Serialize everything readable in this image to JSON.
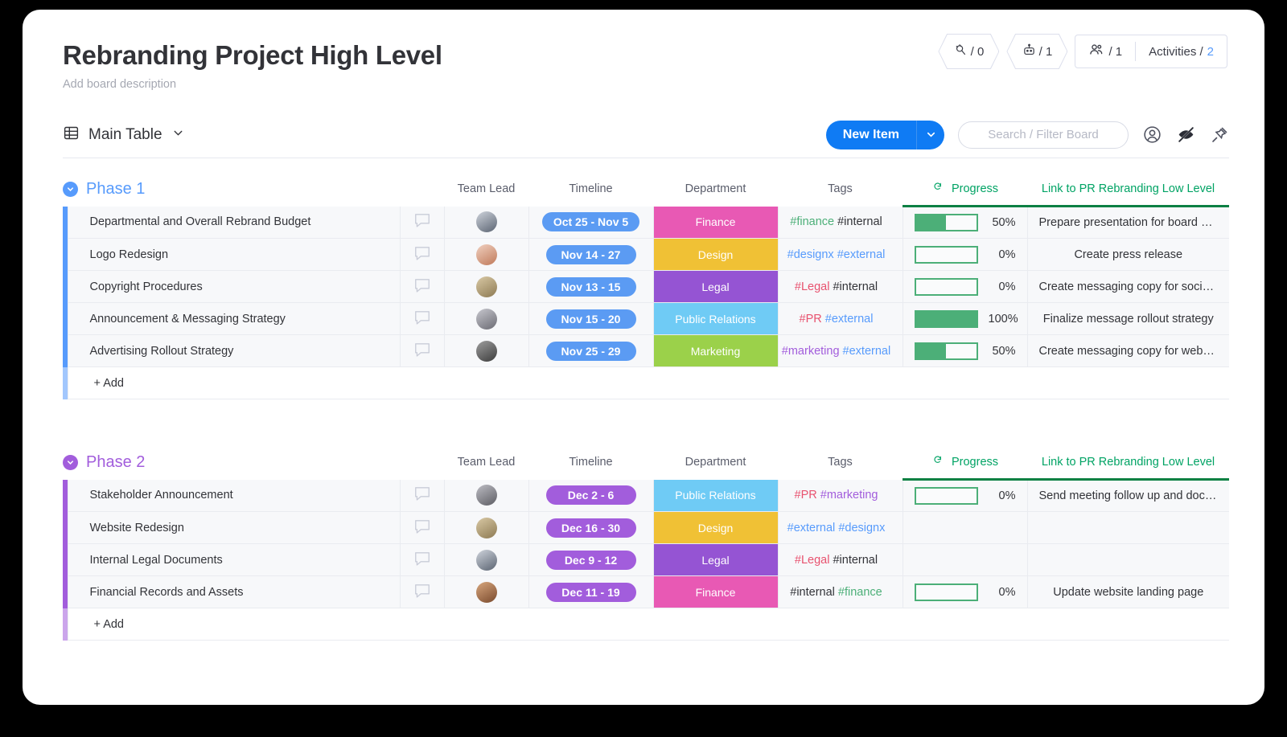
{
  "header": {
    "title": "Rebranding Project High Level",
    "description": "Add board description",
    "badges": [
      {
        "icon": "automation-icon",
        "value": "/ 0"
      },
      {
        "icon": "robot-icon",
        "value": "/ 1"
      }
    ],
    "members": {
      "icon": "people-icon",
      "value": "/ 1"
    },
    "activities": {
      "label": "Activities /",
      "count": "2"
    }
  },
  "toolbar": {
    "view_icon": "table-icon",
    "view_label": "Main Table",
    "view_chevron": "chevron-down-icon",
    "new_item_label": "New Item",
    "new_item_chevron": "chevron-down-icon",
    "search_placeholder": "Search / Filter Board",
    "person_icon": "person-icon",
    "hide_icon": "eye-off-icon",
    "pin_icon": "pin-icon"
  },
  "columns": {
    "team_lead": "Team Lead",
    "timeline": "Timeline",
    "department": "Department",
    "tags": "Tags",
    "progress": "Progress",
    "progress_icon": "rotate-icon",
    "link": "Link to PR Rebranding Low Level"
  },
  "colors": {
    "phase1_accent": "#579bfc",
    "phase2_accent": "#a25ddc",
    "finance": "#e859b4",
    "design": "#f0c135",
    "legal": "#9554d3",
    "public_relations": "#6fcbf5",
    "marketing": "#9bd14a",
    "progress_green": "#4caf78",
    "header_green": "#00a364",
    "new_item_blue": "#0f7bf4"
  },
  "add_row_label": "+ Add",
  "groups": [
    {
      "name": "Phase 1",
      "accent": "#579bfc",
      "rows": [
        {
          "name": "Departmental and Overall Rebrand Budget",
          "avatar": [
            "#5b6472",
            "#cfd4dc"
          ],
          "timeline": "Oct 25 - Nov 5",
          "timeline_color": "#5b9bf3",
          "department": "Finance",
          "department_color": "#e859b4",
          "tags": [
            {
              "text": "#finance",
              "color": "#4caf78"
            },
            {
              "text": "#internal",
              "color": "#323338"
            }
          ],
          "progress": 50,
          "progress_label": "50%",
          "link": "Prepare presentation for board memb…"
        },
        {
          "name": "Logo Redesign",
          "avatar": [
            "#c07a5a",
            "#f0d0c0"
          ],
          "timeline": "Nov 14 - 27",
          "timeline_color": "#5b9bf3",
          "department": "Design",
          "department_color": "#f0c135",
          "tags": [
            {
              "text": "#designx",
              "color": "#579bfc"
            },
            {
              "text": "#external",
              "color": "#579bfc"
            }
          ],
          "progress": 0,
          "progress_label": "0%",
          "link": "Create press release"
        },
        {
          "name": "Copyright Procedures",
          "avatar": [
            "#8d7a53",
            "#d9c9a5"
          ],
          "timeline": "Nov 13 - 15",
          "timeline_color": "#5b9bf3",
          "department": "Legal",
          "department_color": "#9554d3",
          "tags": [
            {
              "text": "#Legal",
              "color": "#e8526f"
            },
            {
              "text": "#internal",
              "color": "#323338"
            }
          ],
          "progress": 0,
          "progress_label": "0%",
          "link": "Create messaging copy for social plat…"
        },
        {
          "name": "Announcement & Messaging Strategy",
          "avatar": [
            "#6b6b73",
            "#c8c8cf"
          ],
          "timeline": "Nov 15 - 20",
          "timeline_color": "#5b9bf3",
          "department": "Public Relations",
          "department_color": "#6fcbf5",
          "tags": [
            {
              "text": "#PR",
              "color": "#e8526f"
            },
            {
              "text": "#external",
              "color": "#579bfc"
            }
          ],
          "progress": 100,
          "progress_label": "100%",
          "link": "Finalize message rollout strategy"
        },
        {
          "name": "Advertising Rollout Strategy",
          "avatar": [
            "#3d3d3d",
            "#9e9e9e"
          ],
          "timeline": "Nov 25 - 29",
          "timeline_color": "#5b9bf3",
          "department": "Marketing",
          "department_color": "#9bd14a",
          "tags": [
            {
              "text": "#marketing",
              "color": "#a25ddc"
            },
            {
              "text": "#external",
              "color": "#579bfc"
            }
          ],
          "progress": 50,
          "progress_label": "50%",
          "link": "Create messaging copy for website la…"
        }
      ]
    },
    {
      "name": "Phase 2",
      "accent": "#a25ddc",
      "rows": [
        {
          "name": "Stakeholder Announcement",
          "avatar": [
            "#5d5d63",
            "#bdbdc4"
          ],
          "timeline": "Dec 2 - 6",
          "timeline_color": "#a25ddc",
          "department": "Public Relations",
          "department_color": "#6fcbf5",
          "tags": [
            {
              "text": "#PR",
              "color": "#e8526f"
            },
            {
              "text": "#marketing",
              "color": "#a25ddc"
            }
          ],
          "progress": 0,
          "progress_label": "0%",
          "link": "Send meeting follow up and documen…"
        },
        {
          "name": "Website Redesign",
          "avatar": [
            "#8d7a53",
            "#d9c9a5"
          ],
          "timeline": "Dec 16 - 30",
          "timeline_color": "#a25ddc",
          "department": "Design",
          "department_color": "#f0c135",
          "tags": [
            {
              "text": "#external",
              "color": "#579bfc"
            },
            {
              "text": "#designx",
              "color": "#579bfc"
            }
          ],
          "progress": null,
          "progress_label": "",
          "link": ""
        },
        {
          "name": "Internal Legal Documents",
          "avatar": [
            "#5b6472",
            "#cfd4dc"
          ],
          "timeline": "Dec 9 - 12",
          "timeline_color": "#a25ddc",
          "department": "Legal",
          "department_color": "#9554d3",
          "tags": [
            {
              "text": "#Legal",
              "color": "#e8526f"
            },
            {
              "text": "#internal",
              "color": "#323338"
            }
          ],
          "progress": null,
          "progress_label": "",
          "link": ""
        },
        {
          "name": "Financial Records and Assets",
          "avatar": [
            "#7a4a2d",
            "#d8a77e"
          ],
          "timeline": "Dec 11 - 19",
          "timeline_color": "#a25ddc",
          "department": "Finance",
          "department_color": "#e859b4",
          "tags": [
            {
              "text": "#internal",
              "color": "#323338"
            },
            {
              "text": "#finance",
              "color": "#4caf78"
            }
          ],
          "progress": 0,
          "progress_label": "0%",
          "link": "Update website landing page"
        }
      ]
    }
  ]
}
